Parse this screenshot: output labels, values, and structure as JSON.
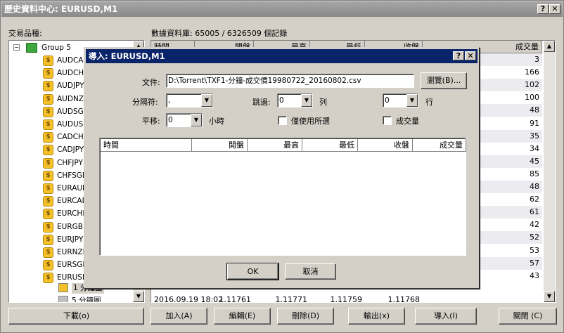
{
  "window": {
    "title": "歷史資料中心: EURUSD,M1",
    "help_btn": "?",
    "close_btn": "✕"
  },
  "left": {
    "label": "交易品種:",
    "group": "Group 5",
    "symbols": [
      "AUDCAD",
      "AUDCHF",
      "AUDJPY",
      "AUDNZD",
      "AUDSGD",
      "AUDUSD",
      "CADCHF",
      "CADJPY",
      "CHFJPY",
      "CHFSGD",
      "EURAUD",
      "EURCAD",
      "EURCHF",
      "EURGBP",
      "EURJPY",
      "EURNZD",
      "EURSGD",
      "EURUSD"
    ],
    "sub_items": [
      "1 分鐘圖",
      "5 分鐘圖"
    ]
  },
  "db": {
    "label": "數據資料庫: 65005 / 6326509 個記錄"
  },
  "grid": {
    "headers": [
      "時間",
      "開盤",
      "最高",
      "最低",
      "收盤",
      "成交量"
    ],
    "volumes": [
      "3",
      "166",
      "102",
      "100",
      "48",
      "91",
      "35",
      "34",
      "45",
      "85",
      "48",
      "62",
      "61",
      "42",
      "52",
      "53",
      "57",
      "43"
    ],
    "last_row": [
      "2016.09.19 18:02",
      "1.11761",
      "1.11771",
      "1.11759",
      "1.11768",
      "43"
    ]
  },
  "buttons": {
    "download": "下載(o)",
    "add": "加入(A)",
    "edit": "編輯(E)",
    "delete": "刪除(D)",
    "export": "輸出(x)",
    "import": "導入(I)",
    "close": "關閉 (C)"
  },
  "dialog": {
    "title": "導入: EURUSD,M1",
    "help_btn": "?",
    "close_btn": "✕",
    "file_label": "文件:",
    "file_value": "D:\\Torrent\\TXF1-分鐘-成交價19980722_20160802.csv",
    "browse": "瀏覽(B)...",
    "sep_label": "分隔符:",
    "sep_value": ",",
    "skip_label": "跳過:",
    "skip_value": "0",
    "col_label": "列",
    "rows_value": "0",
    "row_label": "行",
    "shift_label": "平移:",
    "shift_value": "0",
    "hours_label": "小時",
    "selected_only": "僅使用所選",
    "volume_chk": "成交量",
    "preview_headers": [
      "時間",
      "開盤",
      "最高",
      "最低",
      "收盤",
      "成交量"
    ],
    "ok": "OK",
    "cancel": "取消"
  }
}
